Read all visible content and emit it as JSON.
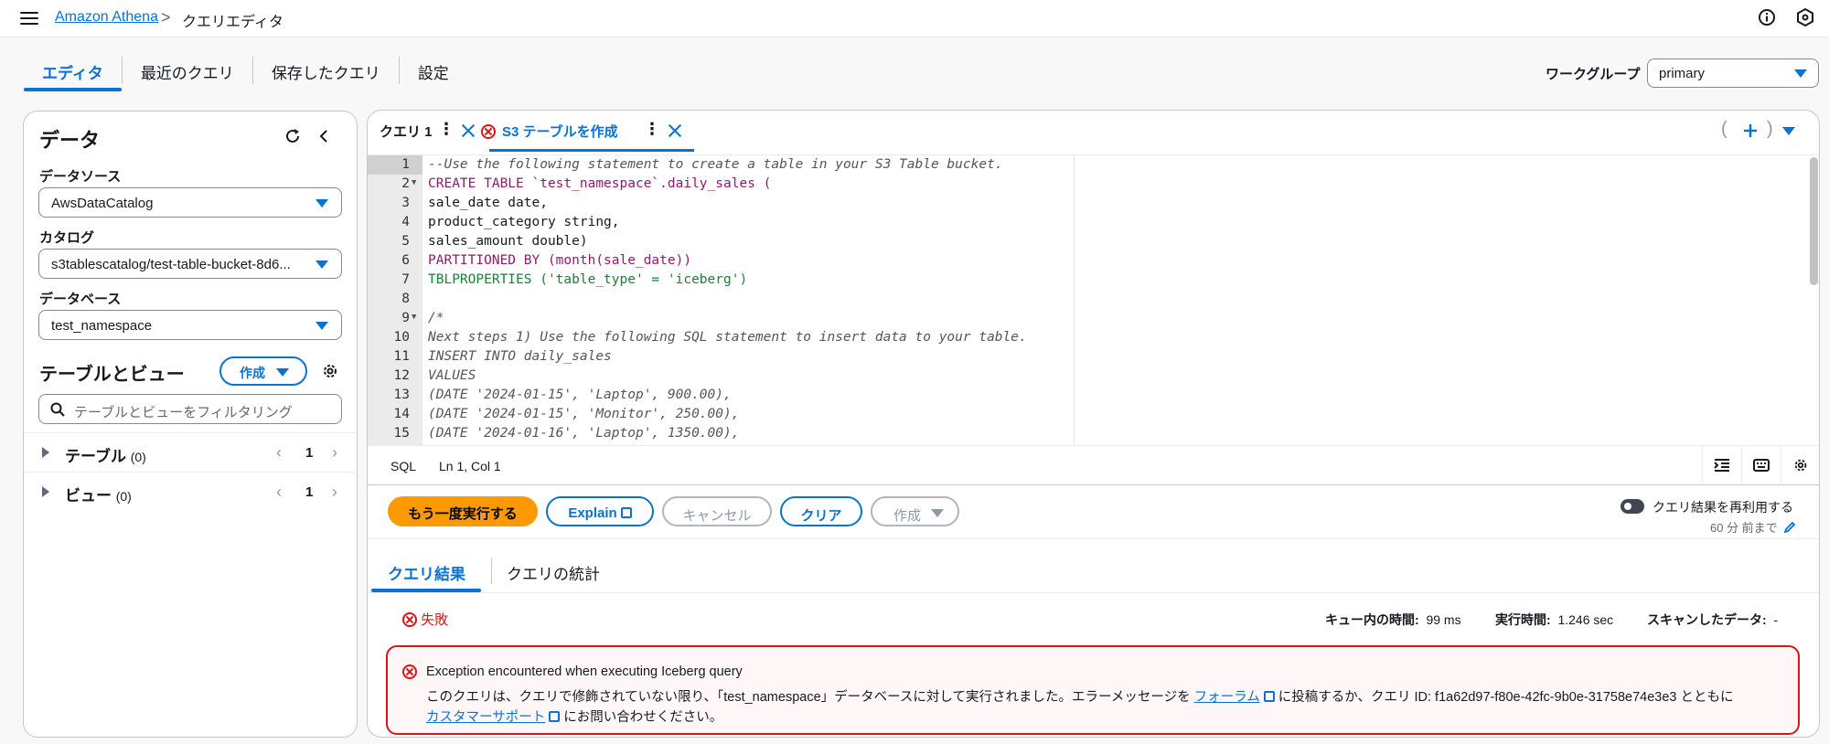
{
  "topbar": {
    "breadcrumb_home": "Amazon Athena",
    "breadcrumb_separator": ">",
    "breadcrumb_current": "クエリエディタ"
  },
  "main_tabs": [
    {
      "label": "エディタ",
      "active": true
    },
    {
      "label": "最近のクエリ",
      "active": false
    },
    {
      "label": "保存したクエリ",
      "active": false
    },
    {
      "label": "設定",
      "active": false
    }
  ],
  "workgroup": {
    "label": "ワークグループ",
    "value": "primary"
  },
  "data_panel": {
    "title": "データ",
    "datasource_label": "データソース",
    "datasource_value": "AwsDataCatalog",
    "catalog_label": "カタログ",
    "catalog_value": "s3tablescatalog/test-table-bucket-8d6...",
    "database_label": "データベース",
    "database_value": "test_namespace",
    "tables_views_title": "テーブルとビュー",
    "create_label": "作成",
    "filter_placeholder": "テーブルとビューをフィルタリング",
    "tree": [
      {
        "label": "テーブル",
        "count": "(0)",
        "page": "1"
      },
      {
        "label": "ビュー",
        "count": "(0)",
        "page": "1"
      }
    ]
  },
  "editor_tabs": [
    {
      "label": "クエリ 1",
      "active": false,
      "error": false
    },
    {
      "label": "S3 テーブルを作成",
      "active": true,
      "error": true
    }
  ],
  "code_lines": [
    {
      "n": "1",
      "text": "--Use the following statement to create a table in your S3 Table bucket."
    },
    {
      "n": "2",
      "text": "CREATE TABLE `test_namespace`.daily_sales ("
    },
    {
      "n": "3",
      "text": "sale_date date,"
    },
    {
      "n": "4",
      "text": "product_category string,"
    },
    {
      "n": "5",
      "text": "sales_amount double)"
    },
    {
      "n": "6",
      "text": "PARTITIONED BY (month(sale_date))"
    },
    {
      "n": "7",
      "text": "TBLPROPERTIES ('table_type' = 'iceberg')"
    },
    {
      "n": "8",
      "text": ""
    },
    {
      "n": "9",
      "text": "/*"
    },
    {
      "n": "10",
      "text": "Next steps 1) Use the following SQL statement to insert data to your table."
    },
    {
      "n": "11",
      "text": "INSERT INTO daily_sales"
    },
    {
      "n": "12",
      "text": "VALUES"
    },
    {
      "n": "13",
      "text": "(DATE '2024-01-15', 'Laptop', 900.00),"
    },
    {
      "n": "14",
      "text": "(DATE '2024-01-15', 'Monitor', 250.00),"
    },
    {
      "n": "15",
      "text": "(DATE '2024-01-16', 'Laptop', 1350.00),"
    }
  ],
  "status": {
    "language": "SQL",
    "position": "Ln 1, Col 1"
  },
  "actions": {
    "run_again": "もう一度実行する",
    "explain": "Explain",
    "cancel": "キャンセル",
    "clear": "クリア",
    "create": "作成",
    "reuse_results": "クエリ結果を再利用する",
    "reuse_sub": "60 分 前まで"
  },
  "result_tabs": [
    {
      "label": "クエリ結果",
      "active": true
    },
    {
      "label": "クエリの統計",
      "active": false
    }
  ],
  "result": {
    "status": "失敗",
    "queue_label": "キュー内の時間:",
    "queue_value": "99 ms",
    "exec_label": "実行時間:",
    "exec_value": "1.246 sec",
    "scan_label": "スキャンしたデータ:",
    "scan_value": "-"
  },
  "error": {
    "title": "Exception encountered when executing Iceberg query",
    "line1_pre": "このクエリは、クエリで修飾されていない限り、「test_namespace」データベースに対して実行されました。エラーメッセージを",
    "forum_link": "フォーラム",
    "line1_post": "に投稿するか、クエリ ID: f1a62d97-f80e-42fc-9b0e-31758e74e3e3 とともに",
    "support_link": "カスタマーサポート",
    "line2_post": "にお問い合わせください。"
  },
  "colors": {
    "accent": "#0972d3",
    "primary_button": "#ff9900",
    "error": "#d91515"
  }
}
